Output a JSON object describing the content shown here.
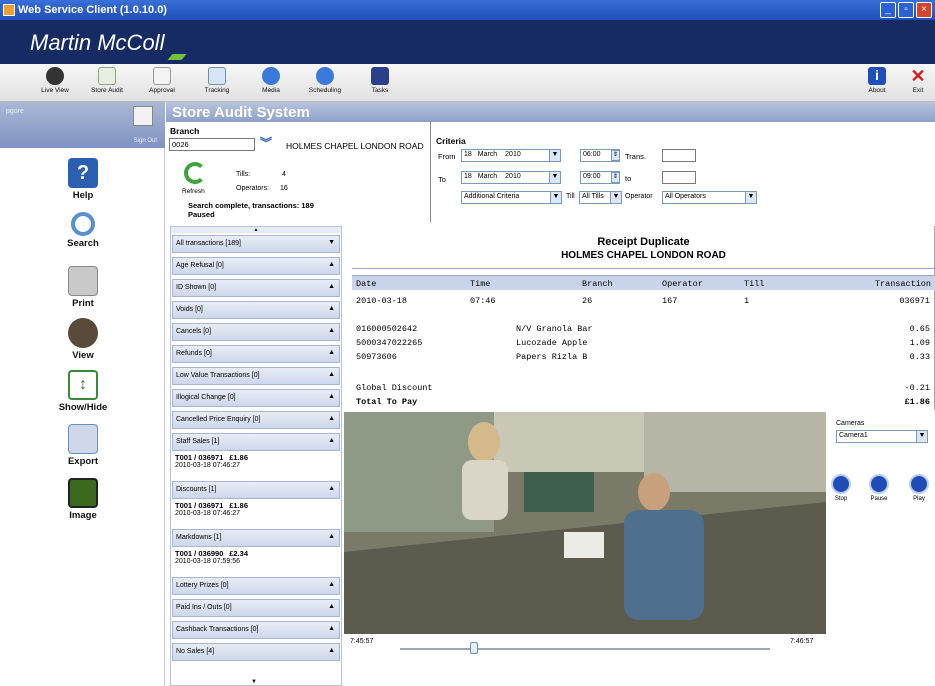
{
  "window": {
    "title": "Web Service Client (1.0.10.0)"
  },
  "brand": {
    "name": "Martin McColl"
  },
  "toolbar": {
    "items": [
      "Live View",
      "Store Audit",
      "Approval",
      "Tracking",
      "Media",
      "Scheduling",
      "Tasks"
    ],
    "right": [
      "About",
      "Exit"
    ]
  },
  "sidebar": {
    "user": "pgore",
    "sign_out": "Sign Out",
    "items": [
      "Help",
      "Search",
      "Print",
      "View",
      "Show/Hide",
      "Export",
      "Image"
    ]
  },
  "page": {
    "title": "Store Audit System"
  },
  "branch": {
    "label": "Branch",
    "code": "0026",
    "name": "HOLMES CHAPEL LONDON ROAD",
    "tills_label": "Tills:",
    "tills_value": "4",
    "operators_label": "Operators:",
    "operators_value": "16",
    "refresh_label": "Refresh",
    "status_line1": "Search complete, transactions: 189",
    "status_line2": "Paused"
  },
  "criteria": {
    "label": "Criteria",
    "from_label": "From",
    "from_day": "18",
    "from_month": "March",
    "from_year": "2010",
    "from_time": "06:00",
    "to_label": "To",
    "to_day": "18",
    "to_month": "March",
    "to_year": "2010",
    "to_time": "09:00",
    "trans_label": "Trans.",
    "to_small_label": "to",
    "additional": "Additional Criteria",
    "till_label": "Till",
    "till_value": "All Tills",
    "operator_label": "Operator",
    "operator_value": "All Operators"
  },
  "filters": [
    {
      "label": "All transactions [189]",
      "arrow": "▼"
    },
    {
      "label": "Age Refusal [0]",
      "arrow": "▲"
    },
    {
      "label": "ID Shown [0]",
      "arrow": "▲"
    },
    {
      "label": "Voids [0]",
      "arrow": "▲"
    },
    {
      "label": "Cancels [0]",
      "arrow": "▲"
    },
    {
      "label": "Refunds [0]",
      "arrow": "▲"
    },
    {
      "label": "Low Value Transactions [0]",
      "arrow": "▲"
    },
    {
      "label": "Illogical Change [0]",
      "arrow": "▲"
    },
    {
      "label": "Cancelled Price Enquiry [0]",
      "arrow": "▲"
    },
    {
      "label": "Staff Sales [1]",
      "arrow": "▲",
      "entry_id": "T001 / 036971",
      "entry_amount": "£1.86",
      "entry_time": "2010-03-18 07:46:27"
    },
    {
      "label": "Discounts [1]",
      "arrow": "▲",
      "entry_id": "T001 / 036971",
      "entry_amount": "£1.86",
      "entry_time": "2010-03-18 07:46:27"
    },
    {
      "label": "Markdowns [1]",
      "arrow": "▲",
      "entry_id": "T001 / 036990",
      "entry_amount": "£2.34",
      "entry_time": "2010-03-18 07:59:56"
    },
    {
      "label": "Lottery Prizes [0]",
      "arrow": "▲"
    },
    {
      "label": "Paid Ins / Outs [0]",
      "arrow": "▲"
    },
    {
      "label": "Cashback Transactions [0]",
      "arrow": "▲"
    },
    {
      "label": "No Sales [4]",
      "arrow": "▲"
    }
  ],
  "receipt": {
    "title": "Receipt Duplicate",
    "store": "HOLMES CHAPEL LONDON ROAD",
    "columns": [
      "Date",
      "Time",
      "Branch",
      "Operator",
      "Till",
      "Transaction"
    ],
    "row": [
      "2010-03-18",
      "07:46",
      "26",
      "167",
      "1",
      "036971"
    ],
    "items": [
      {
        "code": "016000502642",
        "desc": "N/V Granola Bar",
        "price": "0.65"
      },
      {
        "code": "5000347022265",
        "desc": "Lucozade Apple",
        "price": "1.09"
      },
      {
        "code": "50973606",
        "desc": "Papers Rizla B",
        "price": "0.33"
      }
    ],
    "discount_label": "Global Discount",
    "discount_value": "-0.21",
    "total_label": "Total To Pay",
    "total_value": "£1.86"
  },
  "video": {
    "start_time": "7:45:57",
    "end_time": "7:46:57",
    "position": 0.2
  },
  "cameras": {
    "label": "Cameras",
    "selected": "Camera1",
    "buttons": [
      "Stop",
      "Pause",
      "Play"
    ]
  }
}
